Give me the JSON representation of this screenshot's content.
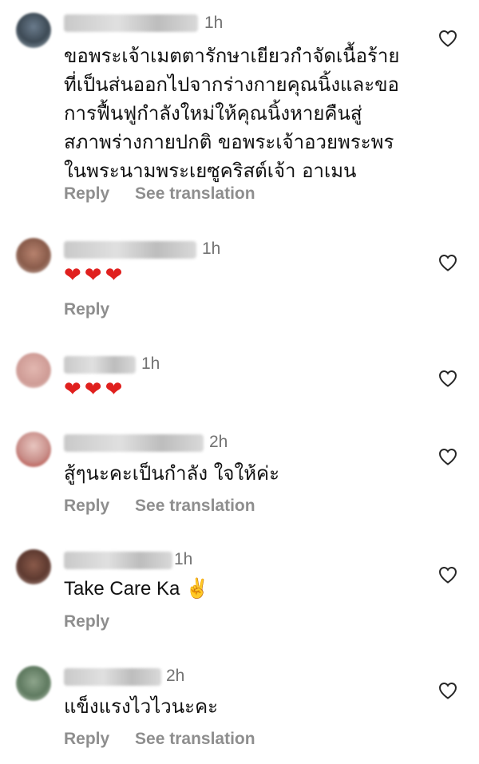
{
  "comments": [
    {
      "username": "",
      "time": "1h",
      "text": "ขอพระเจ้าเมตตารักษาเยียวกำจัดเนื้อร้าย\nที่เป็นส่นออกไปจากร่างกายคุณนิ้งและขอ\nการฟื้นฟูกำลังใหม่ให้คุณนิ้งหายคืนสู่\nสภาพร่างกายปกติ ขอพระเจ้าอวยพระพร\nในพระนามพระเยซูคริสต์เจ้า อาเมน",
      "reply": "Reply",
      "translate": "See translation"
    },
    {
      "username": "",
      "time": "1h",
      "text": "❤❤❤",
      "reply": "Reply"
    },
    {
      "username": "",
      "time": "1h",
      "text": "❤❤❤"
    },
    {
      "username": "",
      "time": "2h",
      "text": "สู้ๆนะคะเป็นกำลัง ใจให้ค่ะ",
      "reply": "Reply",
      "translate": "See translation"
    },
    {
      "username": "",
      "time": "1h",
      "text": "Take Care Ka ✌",
      "reply": "Reply"
    },
    {
      "username": "",
      "time": "2h",
      "text": "แข็งแรงไวไวนะคะ",
      "reply": "Reply",
      "translate": "See translation"
    }
  ],
  "icons": {
    "like": "heart-outline-icon"
  },
  "colors": {
    "meta": "#737373",
    "action": "#8e8e8e",
    "heart": "#e0201e"
  }
}
